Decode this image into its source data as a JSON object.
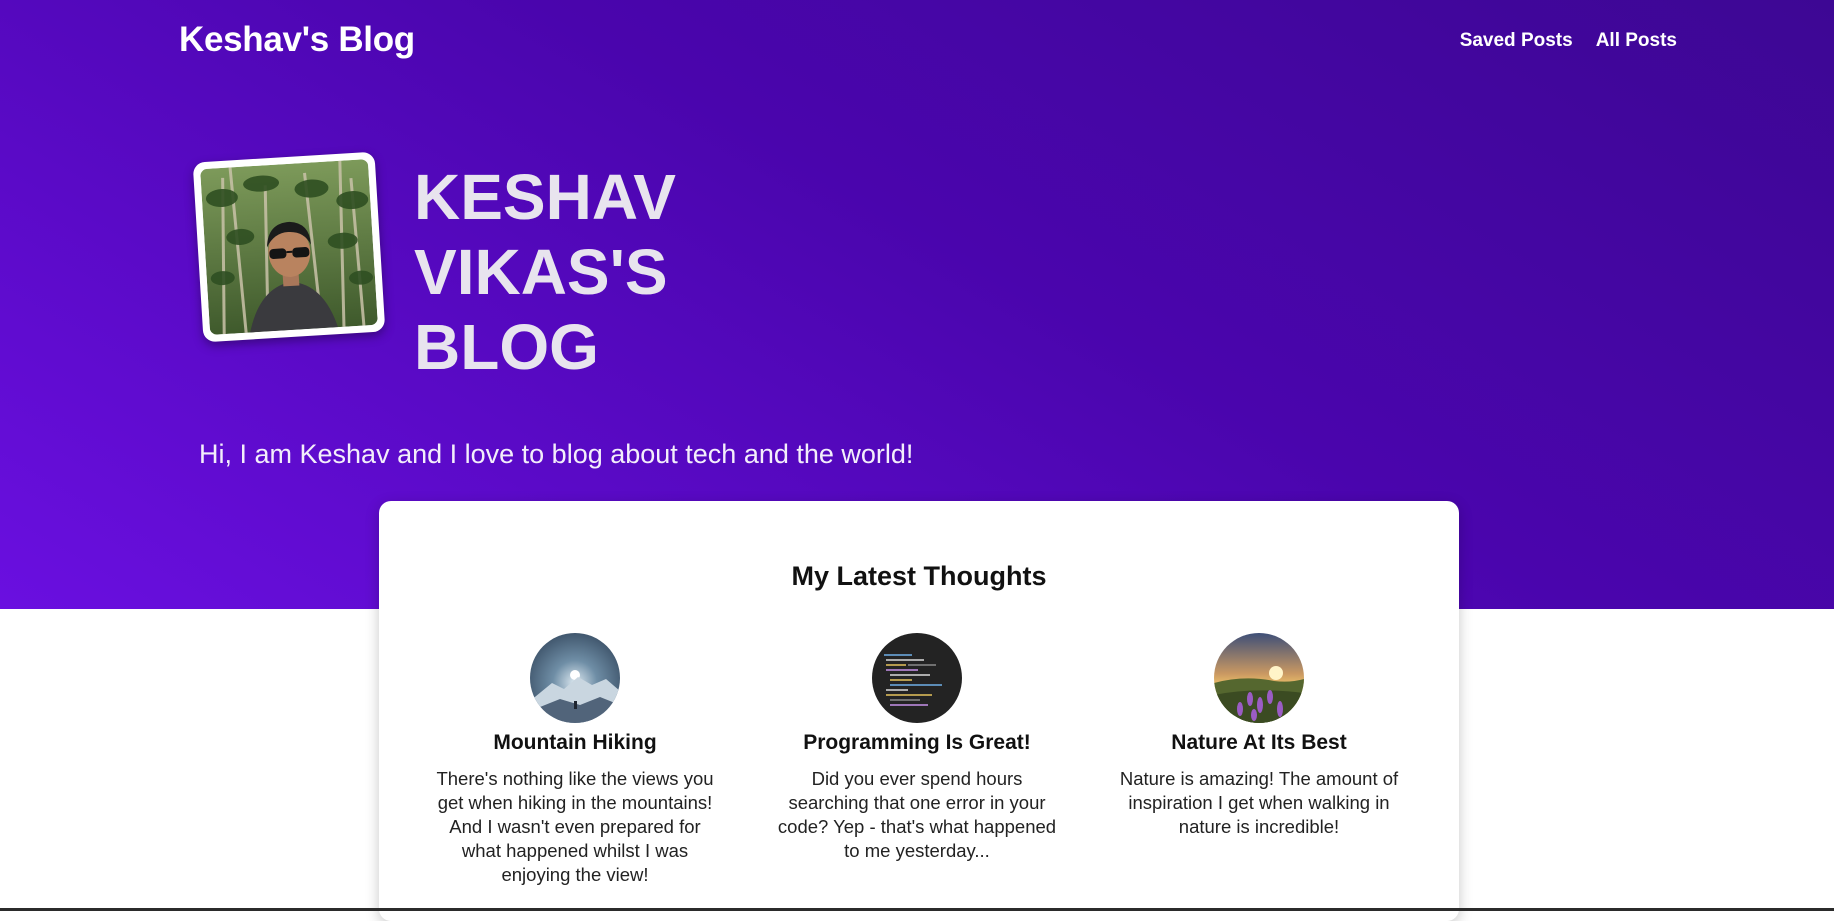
{
  "header": {
    "brand": "Keshav's Blog",
    "nav": [
      {
        "label": "Saved Posts"
      },
      {
        "label": "All Posts"
      }
    ]
  },
  "hero": {
    "title_lines": [
      "KESHAV",
      "VIKAS'S",
      "BLOG"
    ],
    "tagline": "Hi, I am Keshav and I love to blog about tech and the world!",
    "gradient_colors": [
      "#3d0794",
      "#6a0fe0"
    ]
  },
  "latest": {
    "heading": "My Latest Thoughts",
    "posts": [
      {
        "title": "Mountain Hiking",
        "excerpt": "There's nothing like the views you get when hiking in the mountains! And I wasn't even prepared for what happened whilst I was enjoying the view!",
        "thumb_icon": "mountain-photo"
      },
      {
        "title": "Programming Is Great!",
        "excerpt": "Did you ever spend hours searching that one error in your code? Yep - that's what happened to me yesterday...",
        "thumb_icon": "code-screen-photo"
      },
      {
        "title": "Nature At Its Best",
        "excerpt": "Nature is amazing! The amount of inspiration I get when walking in nature is incredible!",
        "thumb_icon": "flower-field-photo"
      }
    ]
  }
}
